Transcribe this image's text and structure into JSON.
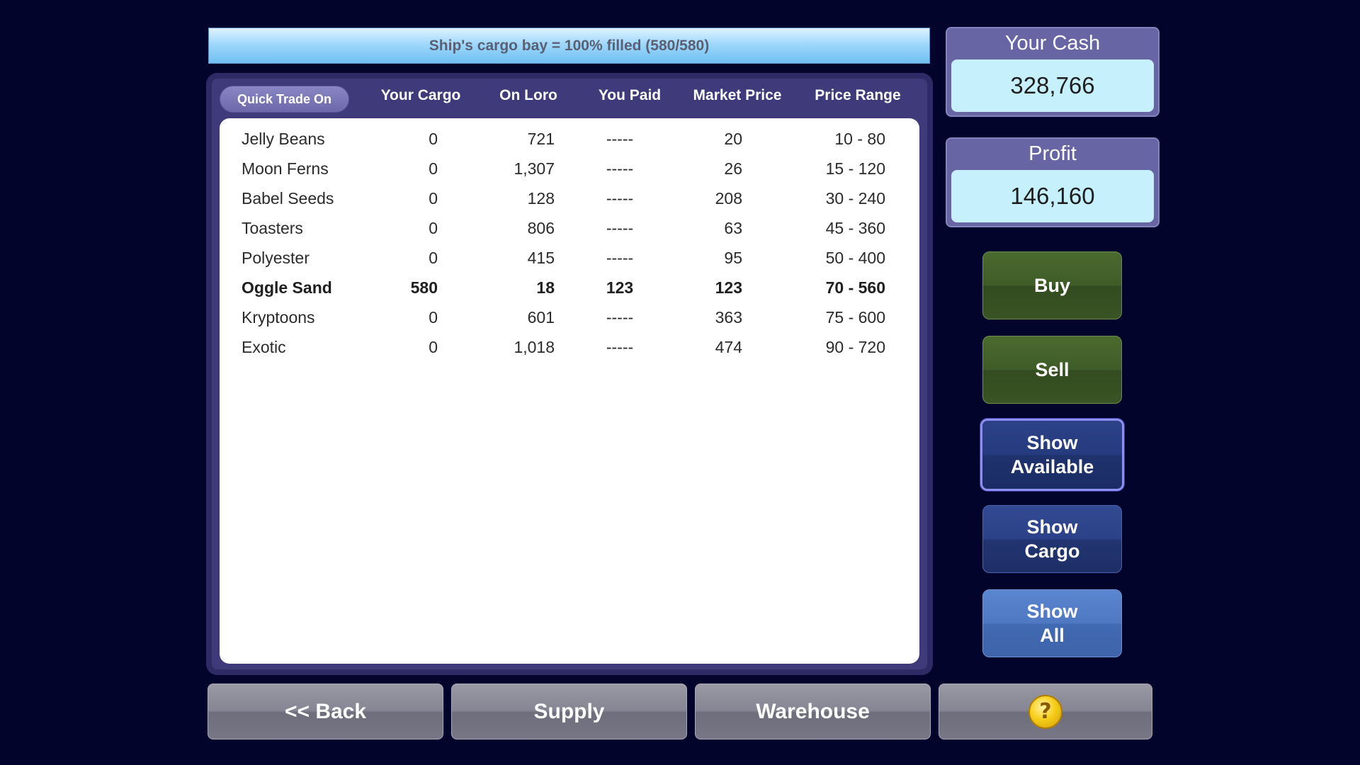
{
  "cargo_status": "Ship's cargo bay = 100% filled (580/580)",
  "quick_trade_label": "Quick Trade On",
  "columns": {
    "cargo": "Your Cargo",
    "planet": "On Loro",
    "paid": "You Paid",
    "market": "Market Price",
    "range": "Price Range"
  },
  "rows": [
    {
      "name": "Jelly Beans",
      "cargo": "0",
      "planet": "721",
      "paid": "-----",
      "market": "20",
      "range": "10 - 80",
      "bold": false
    },
    {
      "name": "Moon Ferns",
      "cargo": "0",
      "planet": "1,307",
      "paid": "-----",
      "market": "26",
      "range": "15 - 120",
      "bold": false
    },
    {
      "name": "Babel Seeds",
      "cargo": "0",
      "planet": "128",
      "paid": "-----",
      "market": "208",
      "range": "30 - 240",
      "bold": false
    },
    {
      "name": "Toasters",
      "cargo": "0",
      "planet": "806",
      "paid": "-----",
      "market": "63",
      "range": "45 - 360",
      "bold": false
    },
    {
      "name": "Polyester",
      "cargo": "0",
      "planet": "415",
      "paid": "-----",
      "market": "95",
      "range": "50 - 400",
      "bold": false
    },
    {
      "name": "Oggle Sand",
      "cargo": "580",
      "planet": "18",
      "paid": "123",
      "market": "123",
      "range": "70 - 560",
      "bold": true
    },
    {
      "name": "Kryptoons",
      "cargo": "0",
      "planet": "601",
      "paid": "-----",
      "market": "363",
      "range": "75 - 600",
      "bold": false
    },
    {
      "name": "Exotic",
      "cargo": "0",
      "planet": "1,018",
      "paid": "-----",
      "market": "474",
      "range": "90 - 720",
      "bold": false
    }
  ],
  "cash": {
    "label": "Your Cash",
    "value": "328,766"
  },
  "profit": {
    "label": "Profit",
    "value": "146,160"
  },
  "side_buttons": {
    "buy": "Buy",
    "sell": "Sell",
    "show_available_1": "Show",
    "show_available_2": "Available",
    "show_cargo_1": "Show",
    "show_cargo_2": "Cargo",
    "show_all_1": "Show",
    "show_all_2": "All"
  },
  "bottom_buttons": {
    "back": "<< Back",
    "supply": "Supply",
    "warehouse": "Warehouse",
    "help_icon": "question-mark-icon",
    "help_glyph": "?"
  },
  "colors": {
    "background": "#03042b",
    "table_frame": "#3f3b7a",
    "stat_value_bg": "#c7f0fd",
    "buy_sell_green": "#3f5c28",
    "show_blue": "#2c4187"
  }
}
